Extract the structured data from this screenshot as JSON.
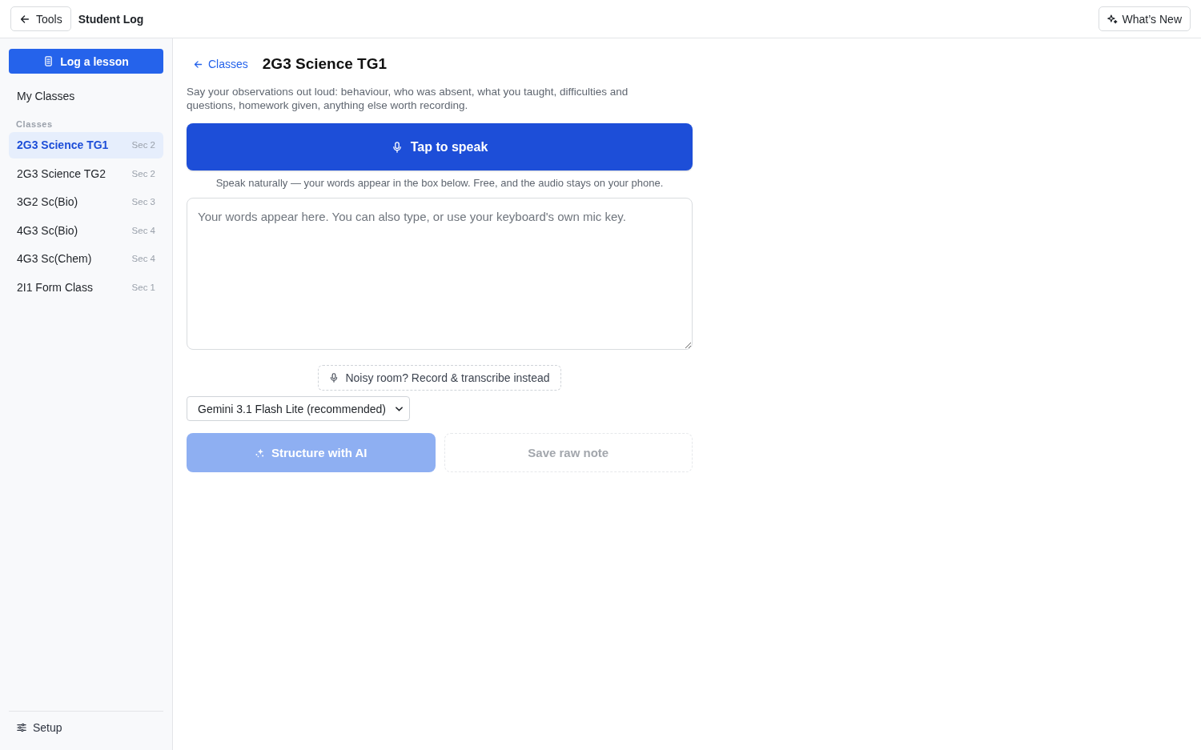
{
  "header": {
    "back_button": "Tools",
    "title": "Student Log",
    "whats_new_button": "What’s New"
  },
  "sidebar": {
    "primary_button": "Log a lesson",
    "nav_items": [
      {
        "label": "My Classes",
        "selected": false
      }
    ],
    "section_label": "Classes",
    "classes": [
      {
        "name": "2G3 Science TG1",
        "tag": "Sec 2",
        "selected": true
      },
      {
        "name": "2G3 Science TG2",
        "tag": "Sec 2",
        "selected": false
      },
      {
        "name": "3G2 Sc(Bio)",
        "tag": "Sec 3",
        "selected": false
      },
      {
        "name": "4G3 Sc(Bio)",
        "tag": "Sec 4",
        "selected": false
      },
      {
        "name": "4G3 Sc(Chem)",
        "tag": "Sec 4",
        "selected": false
      },
      {
        "name": "2I1 Form Class",
        "tag": "Sec 1",
        "selected": false
      }
    ],
    "footer_item": "Setup"
  },
  "main": {
    "back_link": "Classes",
    "title": "2G3 Science TG1",
    "instructions": "Say your observations out loud: behaviour, who was absent, what you taught, difficulties and questions, homework given, anything else worth recording.",
    "speak_button": "Tap to speak",
    "speak_hint": "Speak naturally — your words appear in the box below. Free, and the audio stays on your phone.",
    "transcript": {
      "placeholder": "Your words appear here. You can also type, or use your keyboard's own mic key."
    },
    "record_button": "Noisy room? Record & transcribe instead",
    "model_select": {
      "value": "Gemini 3.1 Flash Lite (recommended)"
    },
    "structure_button": {
      "label": "Structure with AI",
      "disabled": true
    },
    "save_button": {
      "label": "Save raw note",
      "disabled": true
    }
  }
}
